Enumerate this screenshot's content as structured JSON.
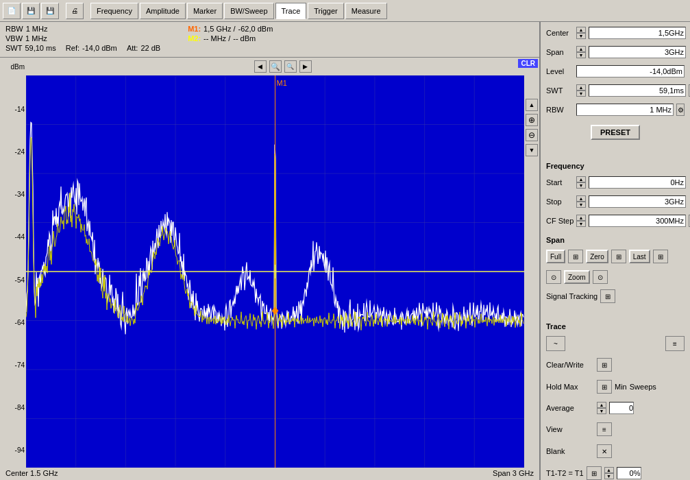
{
  "toolbar": {
    "tabs": [
      {
        "id": "frequency",
        "label": "Frequency"
      },
      {
        "id": "amplitude",
        "label": "Amplitude"
      },
      {
        "id": "marker",
        "label": "Marker"
      },
      {
        "id": "bwsweep",
        "label": "BW/Sweep"
      },
      {
        "id": "trace",
        "label": "Trace",
        "active": true
      },
      {
        "id": "trigger",
        "label": "Trigger"
      },
      {
        "id": "measure",
        "label": "Measure"
      }
    ]
  },
  "status": {
    "rbw_label": "RBW",
    "rbw_value": "1 MHz",
    "vbw_label": "VBW",
    "vbw_value": "1 MHz",
    "swt_label": "SWT",
    "swt_value": "59,10 ms",
    "ref_label": "Ref:",
    "ref_value": "-14,0 dBm",
    "m1_label": "M1:",
    "m1_freq": "1,5 GHz /",
    "m1_val": "-62,0 dBm",
    "m2_label": "M2:",
    "m2_freq": "-- MHz /",
    "m2_val": "-- dBm",
    "att_label": "Att:",
    "att_value": "22 dB"
  },
  "chart": {
    "clr": "CLR",
    "y_labels": [
      "-14",
      "-24",
      "-34",
      "-44",
      "-54",
      "-64",
      "-74",
      "-84",
      "-94"
    ],
    "dbm_label": "dBm",
    "center_label": "Center 1.5 GHz",
    "span_label": "Span 3 GHz"
  },
  "right_panel": {
    "center_label": "Center",
    "center_value": "1,5GHz",
    "span_label": "Span",
    "span_value": "3GHz",
    "level_label": "Level",
    "level_value": "-14,0dBm",
    "swt_label": "SWT",
    "swt_value": "59,1ms",
    "rbw_label": "RBW",
    "rbw_value": "1 MHz",
    "preset_label": "PRESET",
    "frequency_section": "Frequency",
    "start_label": "Start",
    "start_value": "0Hz",
    "stop_label": "Stop",
    "stop_value": "3GHz",
    "cf_step_label": "CF Step",
    "cf_step_value": "300MHz",
    "span_section": "Span",
    "full_label": "Full",
    "zero_label": "Zero",
    "last_label": "Last",
    "zoom_label": "Zoom",
    "signal_tracking_label": "Signal Tracking",
    "trace_section": "Trace",
    "clear_write_label": "Clear/Write",
    "hold_max_label": "Hold Max",
    "min_label": "Min",
    "sweeps_label": "Sweeps",
    "sweeps_value": "0",
    "average_label": "Average",
    "view_label": "View",
    "blank_label": "Blank",
    "trace_pos_label": "T1-T2 = T1",
    "trace_pos_value": "0%"
  }
}
